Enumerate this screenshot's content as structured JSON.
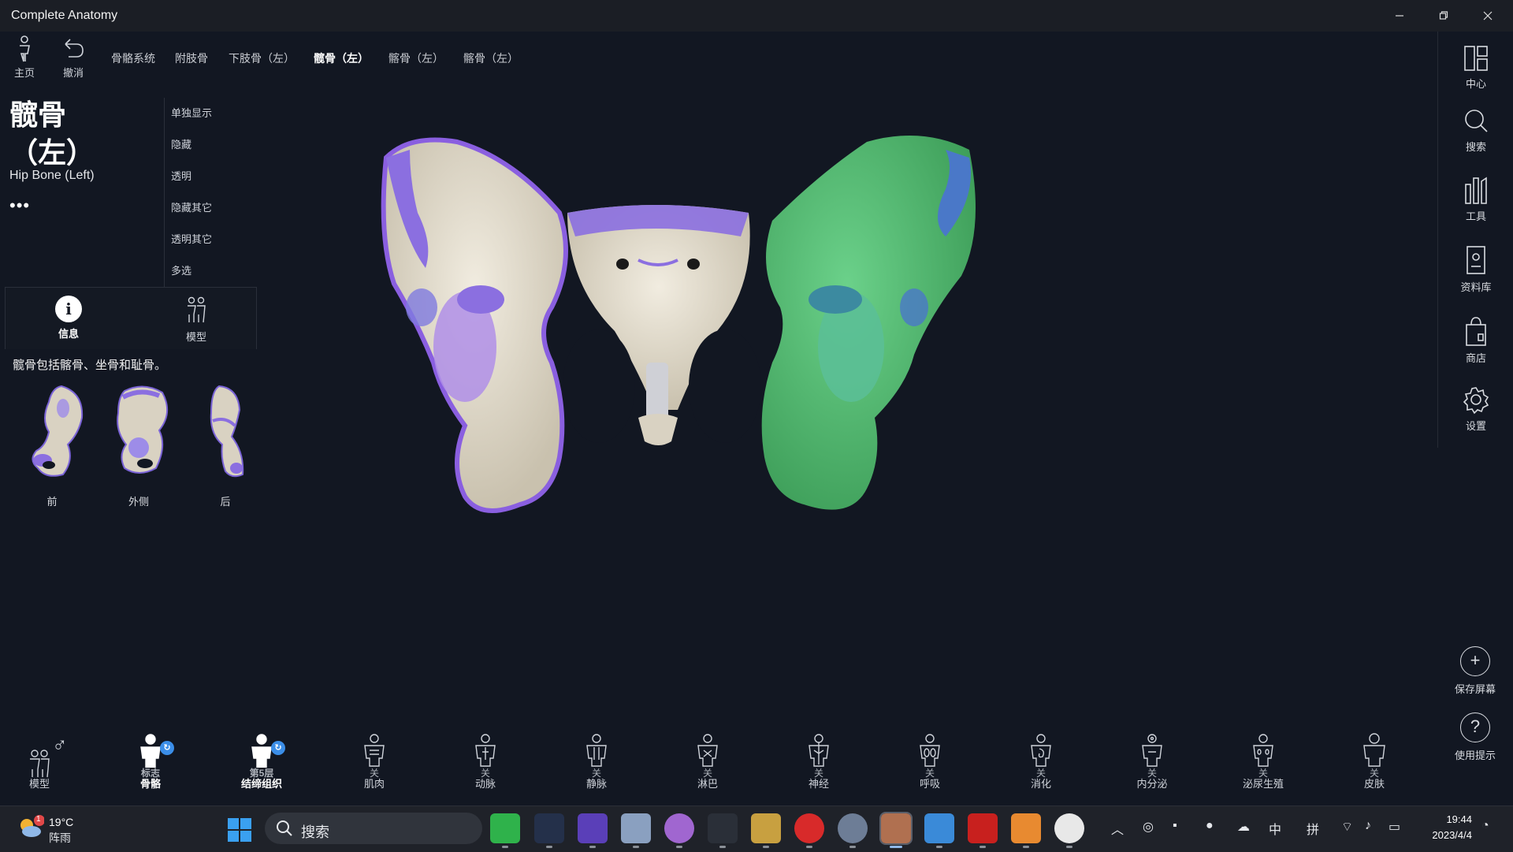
{
  "window": {
    "title": "Complete Anatomy"
  },
  "topnav": {
    "home_label": "主页",
    "undo_label": "撤消",
    "breadcrumbs": [
      "骨骼系统",
      "附肢骨",
      "下肢骨（左）",
      "髋骨（左）",
      "髂骨（左）",
      "髂骨（左）"
    ]
  },
  "structure": {
    "name_line1": "髋骨",
    "name_line2": "（左）",
    "name_en": "Hip Bone (Left)",
    "more": "•••"
  },
  "context_menu": [
    "单独显示",
    "隐藏",
    "透明",
    "隐藏其它",
    "透明其它",
    "多选"
  ],
  "info_panel": {
    "tab_info": "信息",
    "tab_model": "模型",
    "info_icon_glyph": "i",
    "description": "髋骨包括髂骨、坐骨和耻骨。",
    "views": [
      "前",
      "外侧",
      "后"
    ]
  },
  "rightbar": [
    "中心",
    "搜索",
    "工具",
    "资料库",
    "商店",
    "设置"
  ],
  "rightbar_bottom": {
    "save": "保存屏幕",
    "help": "使用提示",
    "plus_glyph": "+",
    "help_glyph": "?"
  },
  "layers": {
    "model_label": "模型",
    "gender_glyph": "♂",
    "items": [
      {
        "state": "标志",
        "name": "骨骼",
        "on": true
      },
      {
        "state": "第5层",
        "name": "结缔组织",
        "on": true
      },
      {
        "state": "关",
        "name": "肌肉",
        "on": false
      },
      {
        "state": "关",
        "name": "动脉",
        "on": false
      },
      {
        "state": "关",
        "name": "静脉",
        "on": false
      },
      {
        "state": "关",
        "name": "淋巴",
        "on": false
      },
      {
        "state": "关",
        "name": "神经",
        "on": false
      },
      {
        "state": "关",
        "name": "呼吸",
        "on": false
      },
      {
        "state": "关",
        "name": "消化",
        "on": false
      },
      {
        "state": "关",
        "name": "内分泌",
        "on": false
      },
      {
        "state": "关",
        "name": "泌尿生殖",
        "on": false
      },
      {
        "state": "关",
        "name": "皮肤",
        "on": false
      }
    ]
  },
  "taskbar": {
    "weather_temp": "19°C",
    "weather_cond": "阵雨",
    "weather_alert": "1",
    "search_label": "搜索",
    "ime_lang": "中",
    "ime_mode": "拼",
    "time": "19:44",
    "date": "2023/4/4"
  },
  "colors": {
    "background": "#121722",
    "bone": "#e3dccb",
    "cartilage_purple": "#8b6fe0",
    "selected_green": "#52c070",
    "accent_blue": "#3b8ee8"
  }
}
